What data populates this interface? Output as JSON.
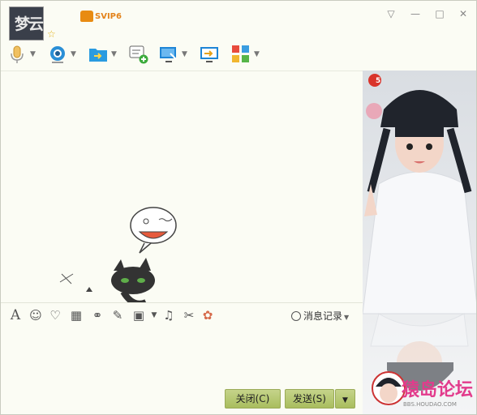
{
  "header": {
    "avatar_caption": "梦云",
    "vip_badge": "SVIP6",
    "window_controls": [
      "▽",
      "—",
      "□",
      "✕"
    ]
  },
  "toolbar": {
    "items": [
      {
        "name": "voice-call",
        "icon": "microphone-icon"
      },
      {
        "name": "video-call",
        "icon": "camera-icon"
      },
      {
        "name": "send-file",
        "icon": "folder-icon"
      },
      {
        "name": "create-discussion",
        "icon": "chat-add-icon"
      },
      {
        "name": "remote-assist",
        "icon": "remote-screen-icon"
      },
      {
        "name": "share-screen",
        "icon": "share-screen-icon"
      },
      {
        "name": "apps",
        "icon": "apps-icon"
      }
    ]
  },
  "input_toolbar": {
    "font_label": "A",
    "history_label": "消息记录"
  },
  "actions": {
    "close_label": "关闭(C)",
    "send_label": "发送(S)"
  },
  "side_panel": {
    "badge_count": "5",
    "watermark_text": "猿岛论坛",
    "watermark_sub": "BBS.HOUDAO.COM"
  },
  "colors": {
    "background": "#fbfcf4",
    "button": "#b3c56a",
    "accent_blue": "#2a8fd6"
  }
}
